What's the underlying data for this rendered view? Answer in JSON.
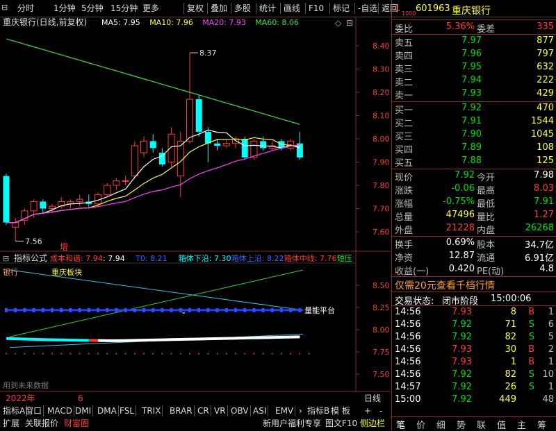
{
  "toolbar": {
    "items": [
      "分时",
      "1分钟",
      "5分钟",
      "15分钟",
      "更多",
      "复权",
      "叠加",
      "多股",
      "统计",
      "画线",
      "F10",
      "标记",
      "-自选",
      "返回"
    ]
  },
  "main_chart": {
    "title": "重庆银行(日线,前复权)",
    "ma_labels": [
      {
        "text": "MA5: 7.95",
        "color": "#ffffff"
      },
      {
        "text": "MA10: 7.96",
        "color": "#ffff40"
      },
      {
        "text": "MA20: 7.93",
        "color": "#ff40ff"
      },
      {
        "text": "MA60: 8.06",
        "color": "#40e040"
      }
    ],
    "high_label": "8.37",
    "low_label": "7.56",
    "add_label": "增",
    "price_axis": [
      "8.40",
      "8.30",
      "8.20",
      "8.10",
      "8.00",
      "7.90",
      "7.80",
      "7.70",
      "7.60"
    ]
  },
  "indicator_chart": {
    "title": "指标公式",
    "labels": [
      {
        "text": "成本和谐: 7.94",
        "color": "#ff4040"
      },
      {
        "text": ": 7.94",
        "color": "#ffffff"
      },
      {
        "text": "T0: 8.21",
        "color": "#4060ff"
      },
      {
        "text": "箱体下沿: 7.30",
        "color": "#00ffff"
      },
      {
        "text": "箱体上沿: 8.22",
        "color": "#4060ff"
      },
      {
        "text": "箱体中线: 7.76",
        "color": "#ff3b3b"
      },
      {
        "text": "短压",
        "color": "#00ff00"
      }
    ],
    "line1_label": "银行",
    "line2_label": "重庆板块",
    "platform_label": "量能平台",
    "future_note": "用到未来数据",
    "axis": [
      "8.50",
      "8.25",
      "8.00",
      "7.75",
      "7.50"
    ]
  },
  "timeline": {
    "year": "2022年",
    "month": "6",
    "period": "日线"
  },
  "bottom_tabs": [
    "指标A",
    "窗口",
    "MACD",
    "DMI",
    "DMA",
    "FSL",
    "TRIX",
    "BRAR",
    "CR",
    "VR",
    "OBV",
    "ASI",
    "EMV"
  ],
  "bottom_right_tabs": [
    "指标B",
    "模 板"
  ],
  "bottom_row2": [
    "扩展",
    "关联报价",
    "财富圈"
  ],
  "bottom_row2_right": [
    "新用户福利专享",
    "图文F10",
    "侧边栏"
  ],
  "stock": {
    "code": "601963",
    "name": "重庆银行",
    "prefix": "L",
    "sub": "1000"
  },
  "commission": {
    "ratio_label": "委比",
    "ratio": "5.36%",
    "diff_label": "委差",
    "diff": "335"
  },
  "asks": [
    {
      "label": "卖五",
      "price": "7.97",
      "vol": "877"
    },
    {
      "label": "卖四",
      "price": "7.96",
      "vol": "797"
    },
    {
      "label": "卖三",
      "price": "7.95",
      "vol": "632"
    },
    {
      "label": "卖二",
      "price": "7.94",
      "vol": "222"
    },
    {
      "label": "卖一",
      "price": "7.93",
      "vol": "429"
    }
  ],
  "bids": [
    {
      "label": "买一",
      "price": "7.92",
      "vol": "470"
    },
    {
      "label": "买二",
      "price": "7.91",
      "vol": "1544"
    },
    {
      "label": "买三",
      "price": "7.90",
      "vol": "1045"
    },
    {
      "label": "买四",
      "price": "7.89",
      "vol": "108"
    },
    {
      "label": "买五",
      "price": "7.88",
      "vol": "125"
    }
  ],
  "quote": [
    {
      "l1": "现价",
      "v1": "7.92",
      "c1": "#00e000",
      "l2": "今开",
      "v2": "7.98",
      "c2": "#ffffff"
    },
    {
      "l1": "涨跌",
      "v1": "-0.06",
      "c1": "#00e000",
      "l2": "最高",
      "v2": "8.03",
      "c2": "#ff3b3b"
    },
    {
      "l1": "涨幅",
      "v1": "-0.75%",
      "c1": "#00e000",
      "l2": "最低",
      "v2": "7.91",
      "c2": "#00e000"
    },
    {
      "l1": "总量",
      "v1": "47496",
      "c1": "#ffff40",
      "l2": "量比",
      "v2": "1.27",
      "c2": "#ff3b3b"
    },
    {
      "l1": "外盘",
      "v1": "21228",
      "c1": "#ff3b3b",
      "l2": "内盘",
      "v2": "26268",
      "c2": "#00e000"
    }
  ],
  "stats": [
    {
      "l1": "换手",
      "v1": "0.69%",
      "l2": "股本",
      "v2": "34.7亿"
    },
    {
      "l1": "净资",
      "v1": "12.87",
      "l2": "流通",
      "v2": "6.91亿"
    },
    {
      "l1": "收益(一)",
      "v1": "0.420",
      "l2": "PE(动)",
      "v2": "4.8"
    }
  ],
  "promo": "仅需20元查看千档行情",
  "trade_status": {
    "label": "交易状态:",
    "state": "闭市阶段",
    "time": "15:00:06"
  },
  "ticks": [
    {
      "time": "14:56",
      "price": "7.93",
      "pc": "#ff3b3b",
      "vol": "8",
      "side": "B",
      "sc": "#ff3b3b",
      "n": "1"
    },
    {
      "time": "14:56",
      "price": "7.92",
      "pc": "#00e000",
      "vol": "71",
      "side": "S",
      "sc": "#00e000",
      "n": "6"
    },
    {
      "time": "14:56",
      "price": "7.92",
      "pc": "#00e000",
      "vol": "82",
      "side": "S",
      "sc": "#00e000",
      "n": "5"
    },
    {
      "time": "14:56",
      "price": "7.93",
      "pc": "#ff3b3b",
      "vol": "30",
      "side": "B",
      "sc": "#ff3b3b",
      "n": "2"
    },
    {
      "time": "14:56",
      "price": "7.93",
      "pc": "#ff3b3b",
      "vol": "1",
      "side": "B",
      "sc": "#ff3b3b",
      "n": "1"
    },
    {
      "time": "14:56",
      "price": "7.92",
      "pc": "#00e000",
      "vol": "82",
      "side": "S",
      "sc": "#00e000",
      "n": "10"
    },
    {
      "time": "14:57",
      "price": "7.92",
      "pc": "#00e000",
      "vol": "26",
      "side": "S",
      "sc": "#00e000",
      "n": "1"
    },
    {
      "time": "15:00",
      "price": "7.92",
      "pc": "#00e000",
      "vol": "449",
      "side": "",
      "sc": "#ffffff",
      "n": "48"
    }
  ],
  "right_tabs": [
    "笔",
    "价",
    "细",
    "势",
    "联",
    "值",
    "主",
    "筹"
  ],
  "candles": [
    {
      "o": 7.84,
      "c": 7.64,
      "h": 7.85,
      "l": 7.63
    },
    {
      "o": 7.62,
      "c": 7.64,
      "h": 7.66,
      "l": 7.56
    },
    {
      "o": 7.65,
      "c": 7.69,
      "h": 7.7,
      "l": 7.63
    },
    {
      "o": 7.69,
      "c": 7.73,
      "h": 7.74,
      "l": 7.66
    },
    {
      "o": 7.73,
      "c": 7.7,
      "h": 7.74,
      "l": 7.68
    },
    {
      "o": 7.7,
      "c": 7.71,
      "h": 7.72,
      "l": 7.68
    },
    {
      "o": 7.71,
      "c": 7.73,
      "h": 7.75,
      "l": 7.7
    },
    {
      "o": 7.72,
      "c": 7.73,
      "h": 7.74,
      "l": 7.7
    },
    {
      "o": 7.73,
      "c": 7.74,
      "h": 7.76,
      "l": 7.71
    },
    {
      "o": 7.73,
      "c": 7.72,
      "h": 7.76,
      "l": 7.7
    },
    {
      "o": 7.72,
      "c": 7.76,
      "h": 7.77,
      "l": 7.71
    },
    {
      "o": 7.76,
      "c": 7.8,
      "h": 7.81,
      "l": 7.75
    },
    {
      "o": 7.8,
      "c": 7.82,
      "h": 7.83,
      "l": 7.78
    },
    {
      "o": 7.82,
      "c": 7.82,
      "h": 7.84,
      "l": 7.8
    },
    {
      "o": 7.84,
      "c": 7.97,
      "h": 7.99,
      "l": 7.83
    },
    {
      "o": 7.94,
      "c": 7.99,
      "h": 8.01,
      "l": 7.92
    },
    {
      "o": 7.99,
      "c": 7.96,
      "h": 8.02,
      "l": 7.94
    },
    {
      "o": 7.94,
      "c": 7.89,
      "h": 7.96,
      "l": 7.88
    },
    {
      "o": 7.9,
      "c": 8.02,
      "h": 8.05,
      "l": 7.88
    },
    {
      "o": 7.84,
      "c": 7.99,
      "h": 8.03,
      "l": 7.75
    },
    {
      "o": 7.99,
      "c": 8.17,
      "h": 8.37,
      "l": 7.98
    },
    {
      "o": 8.17,
      "c": 8.03,
      "h": 8.19,
      "l": 8.01
    },
    {
      "o": 8.03,
      "c": 7.98,
      "h": 8.05,
      "l": 7.9
    },
    {
      "o": 7.98,
      "c": 7.97,
      "h": 8.0,
      "l": 7.95
    },
    {
      "o": 7.97,
      "c": 7.98,
      "h": 8.0,
      "l": 7.96
    },
    {
      "o": 7.98,
      "c": 8.0,
      "h": 8.01,
      "l": 7.96
    },
    {
      "o": 8.0,
      "c": 7.92,
      "h": 8.01,
      "l": 7.91
    },
    {
      "o": 7.92,
      "c": 7.99,
      "h": 8.0,
      "l": 7.91
    },
    {
      "o": 7.99,
      "c": 7.96,
      "h": 8.01,
      "l": 7.95
    },
    {
      "o": 7.96,
      "c": 7.97,
      "h": 7.99,
      "l": 7.95
    },
    {
      "o": 7.99,
      "c": 7.96,
      "h": 8.0,
      "l": 7.95
    },
    {
      "o": 7.96,
      "c": 7.99,
      "h": 8.0,
      "l": 7.95
    },
    {
      "o": 7.98,
      "c": 7.92,
      "h": 8.03,
      "l": 7.91
    }
  ]
}
